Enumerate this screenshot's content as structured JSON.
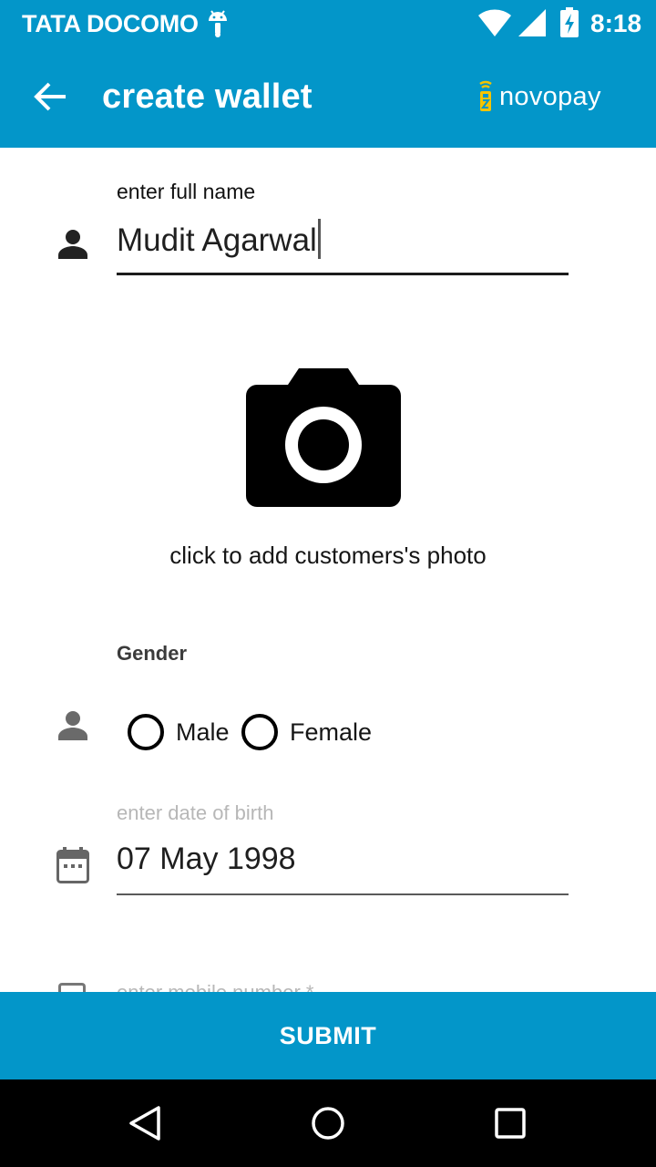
{
  "status_bar": {
    "carrier": "TATA DOCOMO",
    "time": "8:18",
    "icons": [
      "android-icon",
      "wifi-icon",
      "signal-icon",
      "battery-charging-icon"
    ]
  },
  "app_bar": {
    "title": "create wallet",
    "brand": "novopay",
    "back_icon": "arrow-back-icon",
    "brand_color": "#f5c400"
  },
  "form": {
    "name_field": {
      "label": "enter full name",
      "value": "Mudit Agarwal",
      "icon": "person-icon"
    },
    "photo": {
      "icon": "camera-icon",
      "caption": "click to add customers's photo"
    },
    "gender": {
      "label": "Gender",
      "icon": "person-icon",
      "options": [
        "Male",
        "Female"
      ]
    },
    "dob_field": {
      "label": "enter date of birth",
      "value": "07 May 1998",
      "icon": "calendar-icon"
    },
    "mobile_field": {
      "label": "enter mobile number *",
      "icon": "mobile-icon"
    }
  },
  "submit": {
    "label": "SUBMIT"
  },
  "colors": {
    "primary": "#0396c9",
    "text": "#1b1b1b",
    "hint": "#b7b7b7"
  }
}
